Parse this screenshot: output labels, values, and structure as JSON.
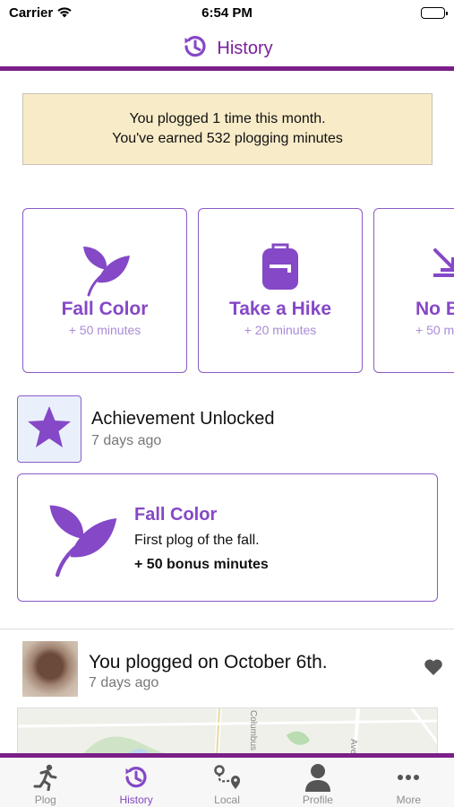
{
  "status_bar": {
    "carrier": "Carrier",
    "time": "6:54 PM"
  },
  "header": {
    "title": "History",
    "icon": "history-icon"
  },
  "summary": {
    "line1": "You plogged 1 time this month.",
    "line2": "You've earned 532 plogging minutes"
  },
  "badges": [
    {
      "title": "Fall Color",
      "minutes": "+ 50 minutes",
      "icon": "leaf-icon"
    },
    {
      "title": "Take a Hike",
      "minutes": "+ 20 minutes",
      "icon": "backpack-icon"
    },
    {
      "title": "No B",
      "minutes": "+ 50 m",
      "icon": "arrow-icon"
    }
  ],
  "achievement": {
    "title": "Achievement Unlocked",
    "time": "7 days ago",
    "card": {
      "title": "Fall Color",
      "description": "First plog of the fall.",
      "bonus": "+ 50 bonus minutes"
    }
  },
  "plog": {
    "title": "You plogged on October 6th.",
    "time": "7 days ago",
    "map_labels": {
      "street1": "Columbus",
      "street2": "Ave"
    }
  },
  "tabs": [
    {
      "label": "Plog",
      "icon": "runner-icon",
      "active": false
    },
    {
      "label": "History",
      "icon": "history-icon",
      "active": true
    },
    {
      "label": "Local",
      "icon": "route-icon",
      "active": false
    },
    {
      "label": "Profile",
      "icon": "person-icon",
      "active": false
    },
    {
      "label": "More",
      "icon": "ellipsis-icon",
      "active": false
    }
  ],
  "colors": {
    "accent": "#7b1f88",
    "badge_purple": "#8548c7",
    "banner": "#f8ebc8"
  }
}
